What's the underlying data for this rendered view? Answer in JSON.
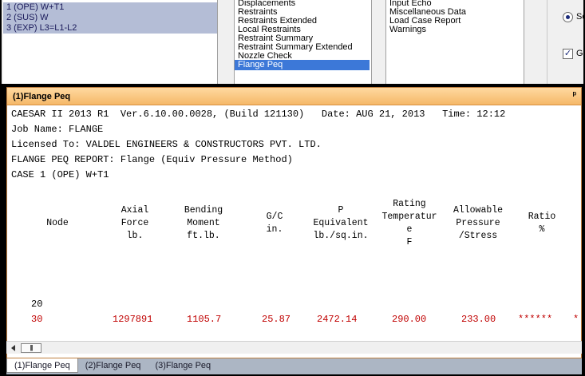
{
  "load_cases": [
    "1 (OPE) W+T1",
    "2 (SUS) W",
    "3 (EXP) L3=L1-L2"
  ],
  "reports": [
    "Displacements",
    "Restraints",
    "Restraints Extended",
    "Local Restraints",
    "Restraint Summary",
    "Restraint Summary Extended",
    "Nozzle Check",
    "Flange Peq"
  ],
  "selected_report": "Flange Peq",
  "misc_reports": [
    "Input Echo",
    "Miscellaneous Data",
    "Load Case Report",
    "Warnings"
  ],
  "options": {
    "radio_label": "Se",
    "checkbox_label": "Ge",
    "checkbox_mark": "✓"
  },
  "window": {
    "title": "(1)Flange Peq",
    "pin": "ᵖ"
  },
  "report": {
    "line1": "CAESAR II 2013 R1  Ver.6.10.00.0028, (Build 121130)   Date: AUG 21, 2013   Time: 12:12",
    "line2": "Job Name: FLANGE",
    "line3": "Licensed To: VALDEL ENGINEERS & CONSTRUCTORS PVT. LTD.",
    "line4": "FLANGE PEQ REPORT: Flange (Equiv Pressure Method)",
    "line5": "CASE 1 (OPE) W+T1",
    "headers": [
      "Node",
      "Axial\nForce\nlb.",
      "Bending\nMoment\nft.lb.",
      "G/C\nin.",
      "P\nEquivalent\nlb./sq.in.",
      "Rating\nTemperatur\ne\nF",
      "Allowable\nPressure\n/Stress",
      "Ratio\n%"
    ],
    "row1": {
      "node": "20"
    },
    "row2": {
      "node": "30",
      "axial": "1297891",
      "bending": "1105.7",
      "gc": "25.87",
      "peq": "2472.14",
      "temp": "290.00",
      "allow": "233.00",
      "ratio": "******",
      "extra": "*"
    }
  },
  "scroll_thumb": "|||",
  "tabs": [
    "(1)Flange Peq",
    "(2)Flange Peq",
    "(3)Flange Peq"
  ],
  "colors": {
    "header_gradient": "#f5b868",
    "selection": "#3c78d8",
    "highlight_row": "#b4bdd6",
    "error_text": "#c00000"
  }
}
